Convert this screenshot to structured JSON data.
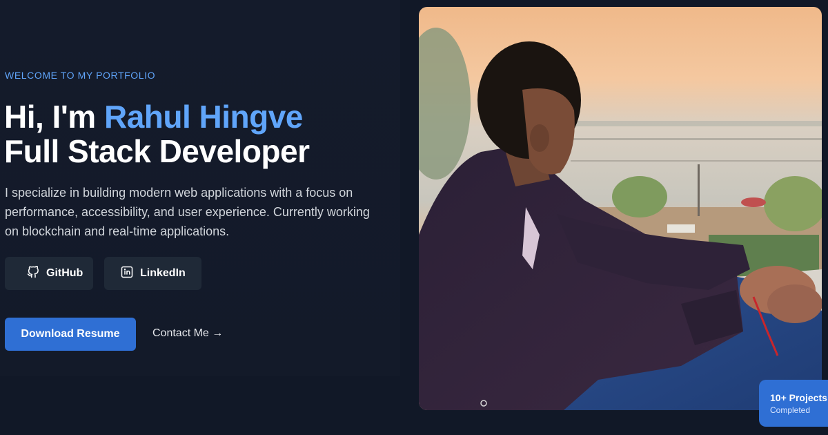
{
  "hero": {
    "eyebrow": "WELCOME TO MY PORTFOLIO",
    "greeting": "Hi, I'm ",
    "name": "Rahul Hingve",
    "role": "Full Stack Developer",
    "intro": "I specialize in building modern web applications with a focus on performance, accessibility, and user experience. Currently working on blockchain and real-time applications."
  },
  "social": {
    "github_label": "GitHub",
    "github_icon": "github-icon",
    "linkedin_label": "LinkedIn",
    "linkedin_icon": "linkedin-icon"
  },
  "actions": {
    "resume_label": "Download Resume",
    "contact_label": "Contact Me →"
  },
  "badge": {
    "title": "10+ Projects",
    "subtitle": "Completed"
  },
  "colors": {
    "background": "#111827",
    "accent": "#60a5fa",
    "primary_button": "#2f6fd4",
    "secondary_button": "#1f2937"
  }
}
